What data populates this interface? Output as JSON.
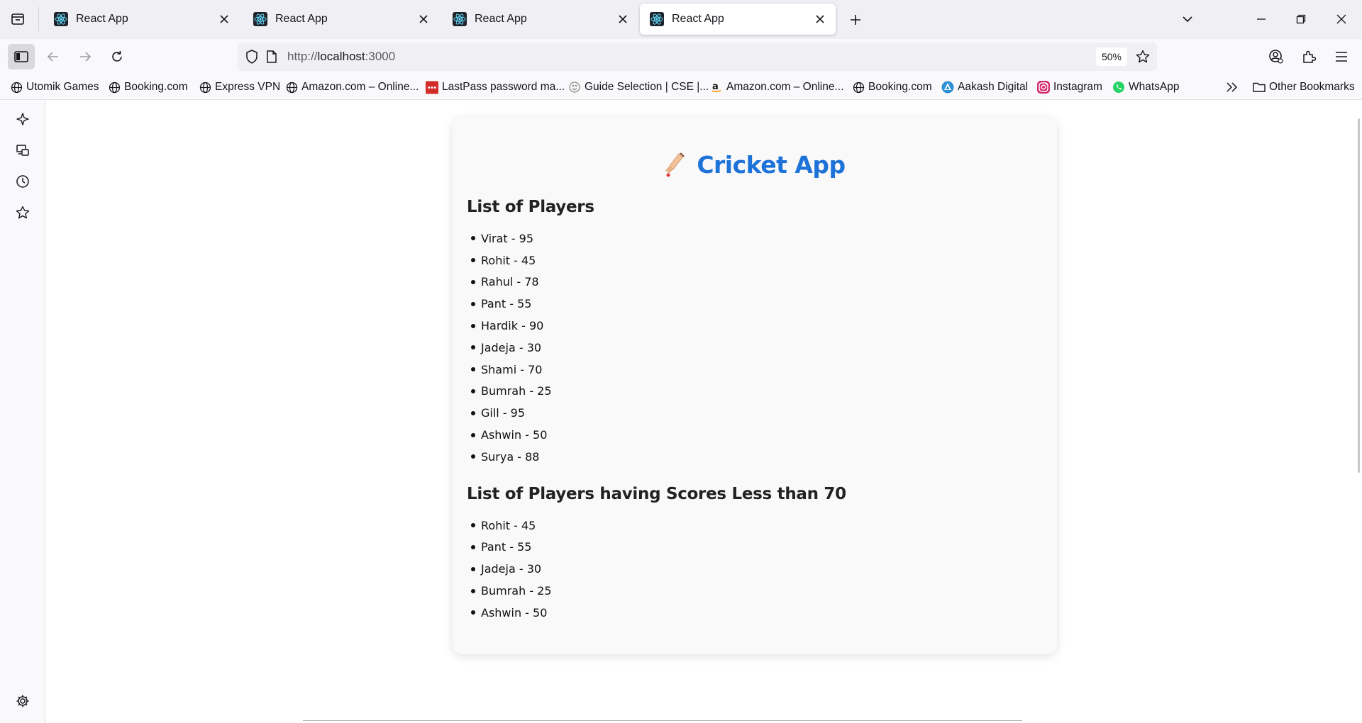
{
  "tabs": [
    {
      "title": "React App",
      "active": false
    },
    {
      "title": "React App",
      "active": false
    },
    {
      "title": "React App",
      "active": false
    },
    {
      "title": "React App",
      "active": true
    }
  ],
  "url": {
    "scheme": "http://",
    "host": "localhost",
    "port": ":3000",
    "zoom": "50%"
  },
  "bookmarks": [
    {
      "label": "Utomik Games",
      "icon": "globe-icon"
    },
    {
      "label": "Booking.com",
      "icon": "globe-icon"
    },
    {
      "label": "Express VPN",
      "icon": "globe-icon"
    },
    {
      "label": "Amazon.com – Online...",
      "icon": "globe-icon"
    },
    {
      "label": "LastPass password ma...",
      "icon": "lastpass-icon"
    },
    {
      "label": "Guide Selection | CSE |...",
      "icon": "guide-icon"
    },
    {
      "label": "Amazon.com – Online...",
      "icon": "amazon-icon"
    },
    {
      "label": "Booking.com",
      "icon": "globe-icon"
    },
    {
      "label": "Aakash Digital",
      "icon": "aakash-icon"
    },
    {
      "label": "Instagram",
      "icon": "instagram-icon"
    },
    {
      "label": "WhatsApp",
      "icon": "whatsapp-icon"
    }
  ],
  "other_bookmarks": "Other Bookmarks",
  "app": {
    "title": "Cricket App",
    "section_all": "List of Players",
    "section_low": "List of Players having Scores Less than 70",
    "players": [
      "Virat - 95",
      "Rohit - 45",
      "Rahul - 78",
      "Pant - 55",
      "Hardik - 90",
      "Jadeja - 30",
      "Shami - 70",
      "Bumrah - 25",
      "Gill - 95",
      "Ashwin - 50",
      "Surya - 88"
    ],
    "low_players": [
      "Rohit - 45",
      "Pant - 55",
      "Jadeja - 30",
      "Bumrah - 25",
      "Ashwin - 50"
    ]
  },
  "colors": {
    "accent": "#1e73d8",
    "tabstrip": "#f0f0f4",
    "toolbar": "#f9f9fb"
  }
}
